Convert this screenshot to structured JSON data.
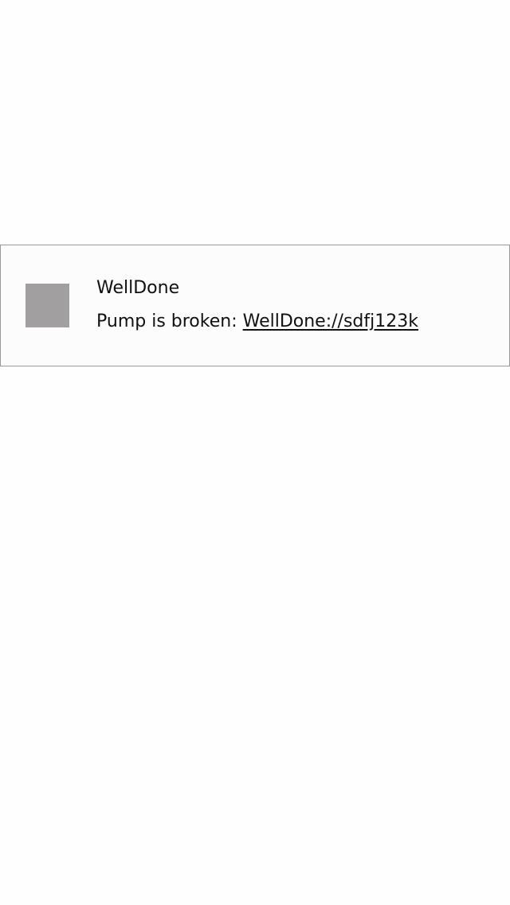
{
  "notification": {
    "icon": "app-icon-placeholder",
    "icon_color": "#a19f9f",
    "app_name": "WellDone",
    "message_prefix": "Pump is broken: ",
    "message_link": "WellDone://sdfj123k"
  }
}
